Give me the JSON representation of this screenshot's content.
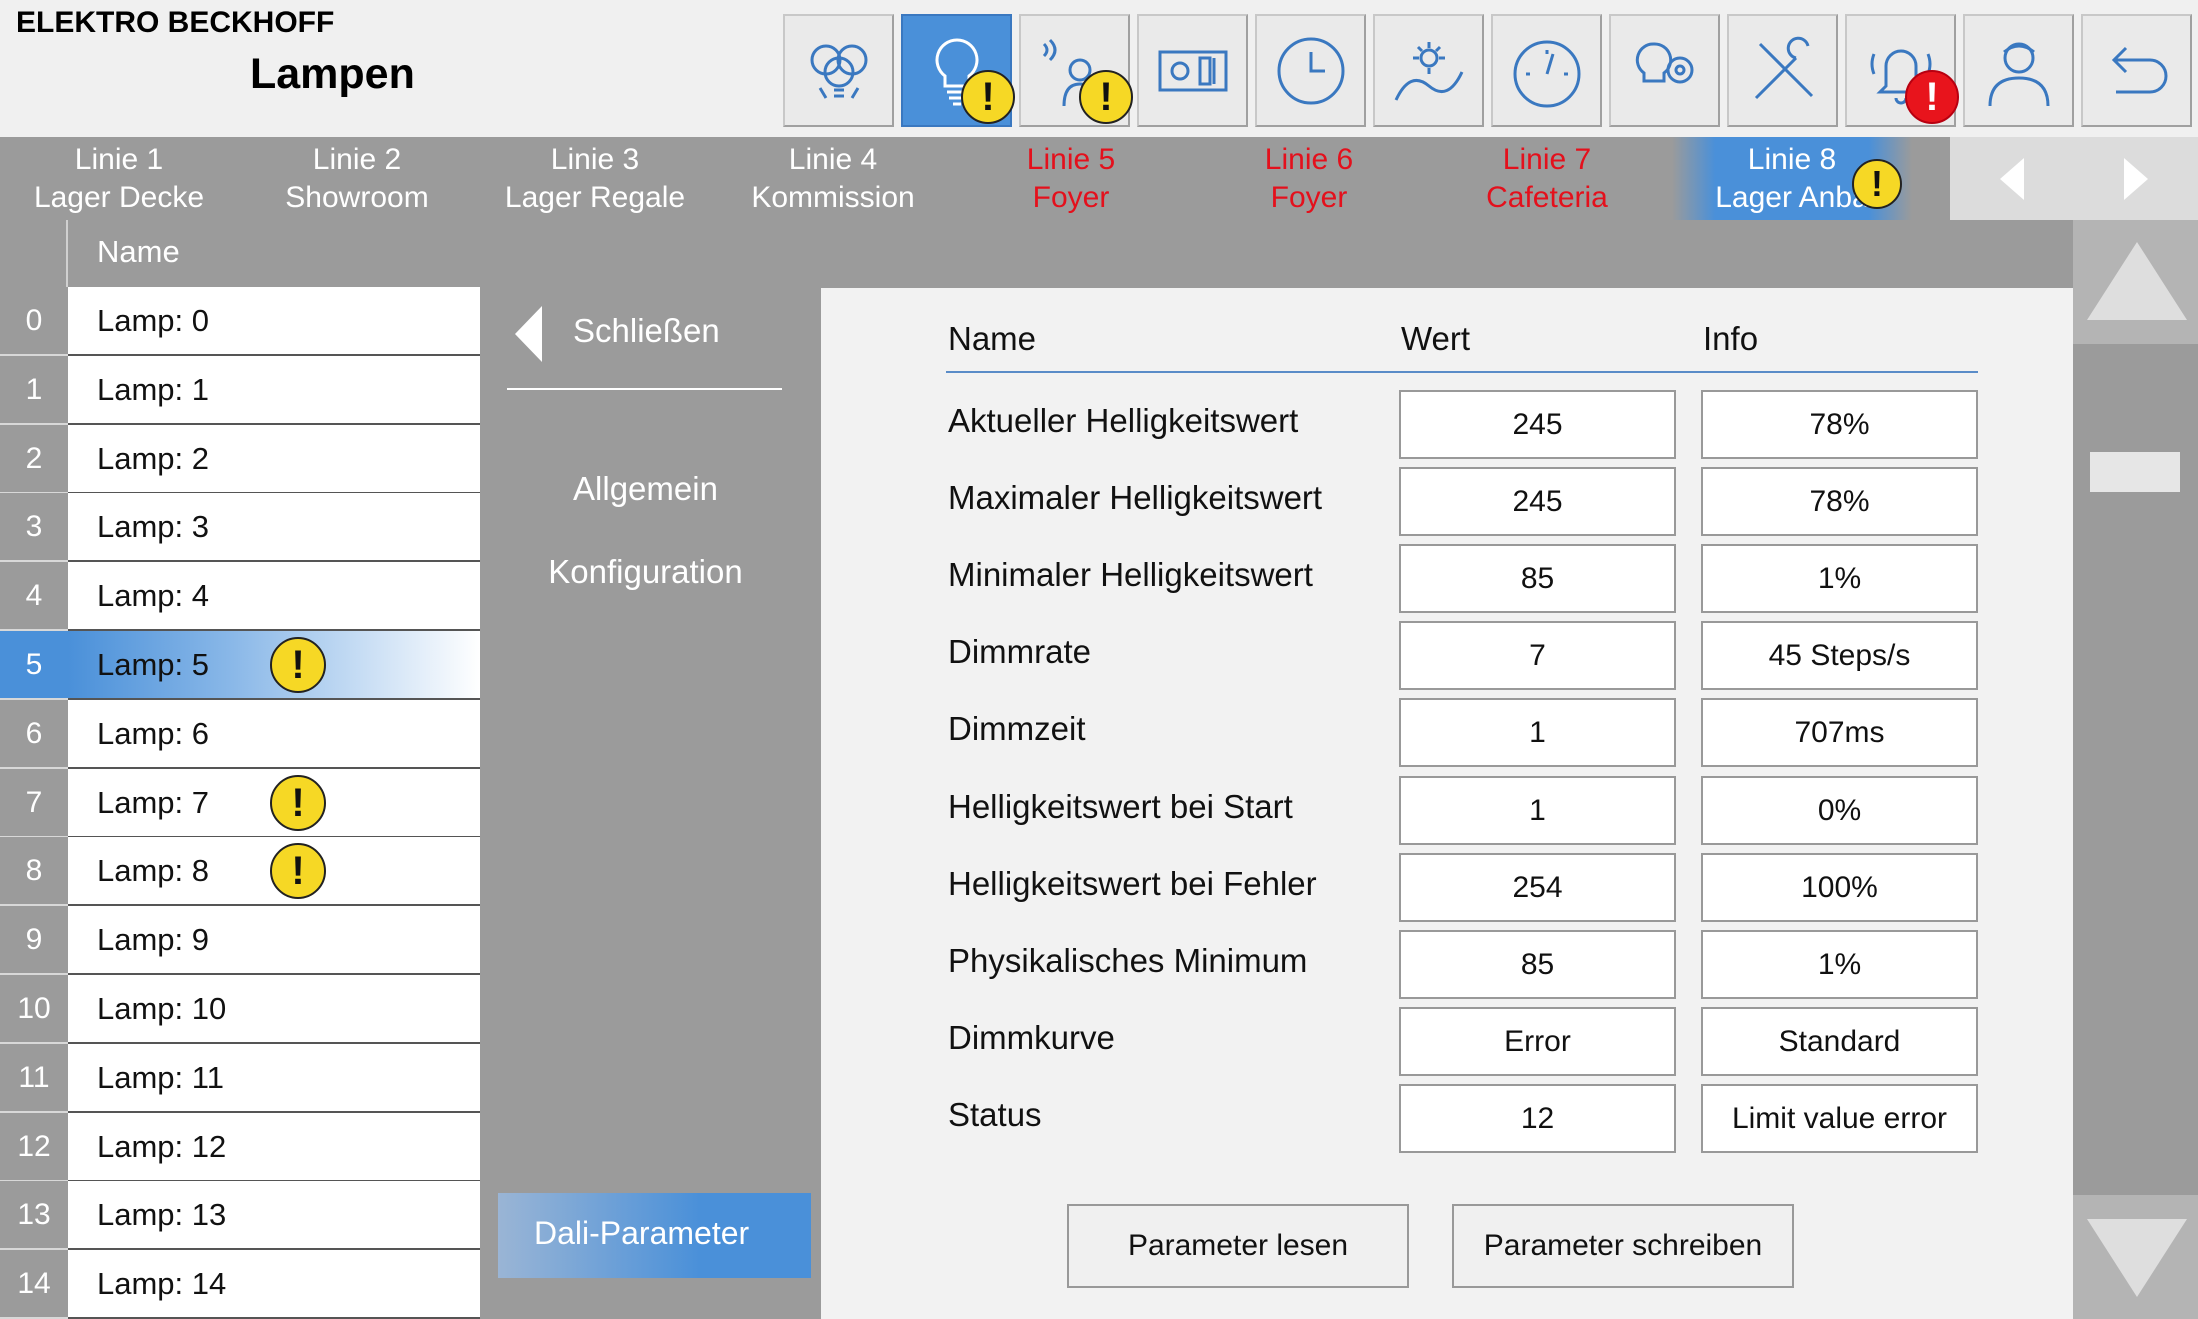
{
  "header": {
    "company": "ELEKTRO BECKHOFF",
    "title": "Lampen",
    "nav_icons": [
      "lamps-group-icon",
      "lamp-icon",
      "presence-sensor-icon",
      "blinds-control-icon",
      "clock-icon",
      "daylight-icon",
      "gauge-icon",
      "settings-bulb-icon",
      "tools-icon",
      "alarm-bell-icon",
      "user-icon",
      "back-icon"
    ],
    "active_nav": "lamp-icon",
    "warning_symbol": "!",
    "error_symbol": "!"
  },
  "tabs": [
    {
      "line1": "Linie 1",
      "line2": "Lager Decke",
      "state": "normal"
    },
    {
      "line1": "Linie 2",
      "line2": "Showroom",
      "state": "normal"
    },
    {
      "line1": "Linie 3",
      "line2": "Lager Regale",
      "state": "normal"
    },
    {
      "line1": "Linie 4",
      "line2": "Kommission",
      "state": "normal"
    },
    {
      "line1": "Linie 5",
      "line2": "Foyer",
      "state": "alarm"
    },
    {
      "line1": "Linie 6",
      "line2": "Foyer",
      "state": "alarm"
    },
    {
      "line1": "Linie 7",
      "line2": "Cafeteria",
      "state": "alarm"
    },
    {
      "line1": "Linie 8",
      "line2": "Lager Anba",
      "state": "active"
    }
  ],
  "lamp_list": {
    "header": "Name",
    "selected_index": 5,
    "items": [
      {
        "index": "0",
        "name": "Lamp: 0",
        "warning": false
      },
      {
        "index": "1",
        "name": "Lamp: 1",
        "warning": false
      },
      {
        "index": "2",
        "name": "Lamp: 2",
        "warning": false
      },
      {
        "index": "3",
        "name": "Lamp: 3",
        "warning": false
      },
      {
        "index": "4",
        "name": "Lamp: 4",
        "warning": false
      },
      {
        "index": "5",
        "name": "Lamp: 5",
        "warning": true
      },
      {
        "index": "6",
        "name": "Lamp: 6",
        "warning": false
      },
      {
        "index": "7",
        "name": "Lamp: 7",
        "warning": true
      },
      {
        "index": "8",
        "name": "Lamp: 8",
        "warning": true
      },
      {
        "index": "9",
        "name": "Lamp: 9",
        "warning": false
      },
      {
        "index": "10",
        "name": "Lamp: 10",
        "warning": false
      },
      {
        "index": "11",
        "name": "Lamp: 11",
        "warning": false
      },
      {
        "index": "12",
        "name": "Lamp: 12",
        "warning": false
      },
      {
        "index": "13",
        "name": "Lamp: 13",
        "warning": false
      },
      {
        "index": "14",
        "name": "Lamp: 14",
        "warning": false
      }
    ]
  },
  "menu": {
    "close": "Schließen",
    "general": "Allgemein",
    "configuration": "Konfiguration",
    "dali": "Dali-Parameter"
  },
  "params": {
    "col_name": "Name",
    "col_value": "Wert",
    "col_info": "Info",
    "rows": [
      {
        "name": "Aktueller Helligkeitswert",
        "value": "245",
        "info": "78%"
      },
      {
        "name": "Maximaler Helligkeitswert",
        "value": "245",
        "info": "78%"
      },
      {
        "name": "Minimaler Helligkeitswert",
        "value": "85",
        "info": "1%"
      },
      {
        "name": "Dimmrate",
        "value": "7",
        "info": "45 Steps/s"
      },
      {
        "name": "Dimmzeit",
        "value": "1",
        "info": "707ms"
      },
      {
        "name": "Helligkeitswert bei Start",
        "value": "1",
        "info": "0%"
      },
      {
        "name": "Helligkeitswert bei Fehler",
        "value": "254",
        "info": "100%"
      },
      {
        "name": "Physikalisches Minimum",
        "value": "85",
        "info": "1%"
      },
      {
        "name": "Dimmkurve",
        "value": "Error",
        "info": "Standard"
      },
      {
        "name": "Status",
        "value": "12",
        "info": "Limit value error"
      }
    ],
    "read_button": "Parameter lesen",
    "write_button": "Parameter schreiben"
  },
  "colors": {
    "accent": "#4a90d9",
    "panel_gray": "#9b9b9b",
    "alarm_red": "#e4101c",
    "warning_yellow": "#f6d825"
  }
}
